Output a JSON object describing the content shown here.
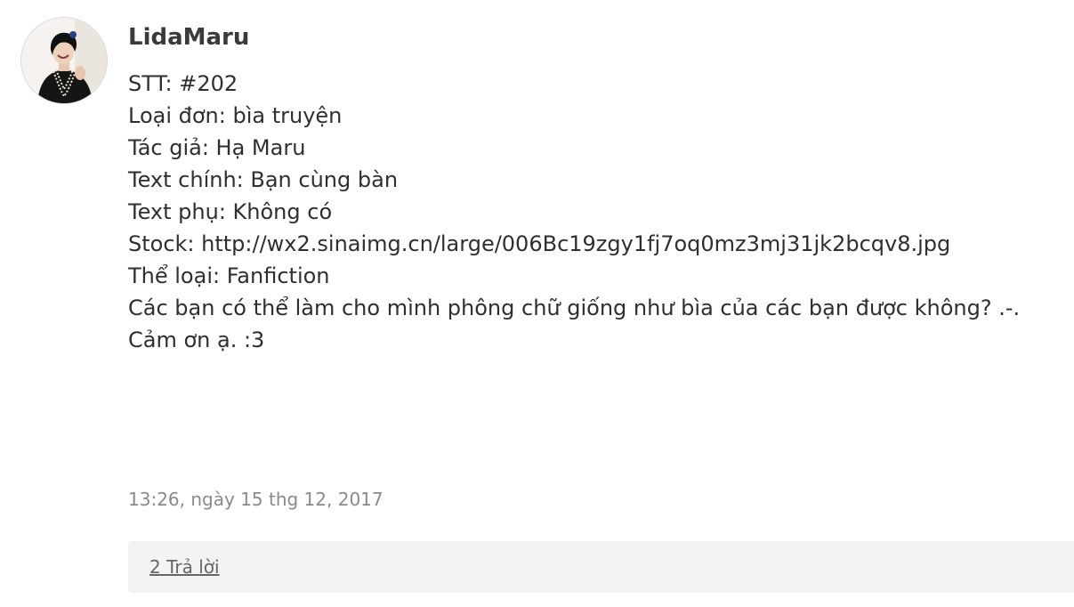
{
  "comment": {
    "avatar_icon": "user-avatar-photo",
    "author": "LidaMaru",
    "lines": [
      "STT: #202",
      "Loại đơn: bìa truyện",
      "Tác giả: Hạ Maru",
      "Text chính: Bạn cùng bàn",
      "Text phụ: Không có",
      "Stock: http://wx2.sinaimg.cn/large/006Bc19zgy1fj7oq0mz3mj31jk2bcqv8.jpg",
      "Thể loại: Fanfiction",
      "Các bạn có thể làm cho mình phông chữ giống như bìa của các bạn được không? .-.",
      "Cảm ơn ạ. :3"
    ],
    "timestamp": "13:26, ngày 15 thg 12, 2017",
    "replies_label": "2 Trả lời"
  },
  "colors": {
    "author": "#3a3a3a",
    "body_text": "#2f2f2f",
    "timestamp": "#8a8a8a",
    "replies_bg": "#f3f3f3",
    "replies_link": "#666666"
  }
}
